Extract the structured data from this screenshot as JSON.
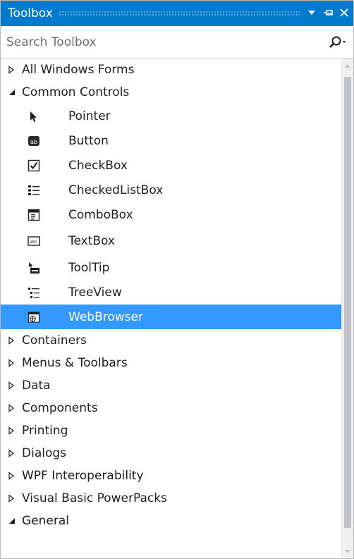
{
  "window": {
    "title": "Toolbox",
    "buttons": [
      "dropdown-icon",
      "pin-icon",
      "close-icon"
    ]
  },
  "search": {
    "placeholder": "Search Toolbox",
    "value": ""
  },
  "groups": [
    {
      "label": "All Windows Forms",
      "expanded": false
    },
    {
      "label": "Common Controls",
      "expanded": true,
      "items": [
        {
          "label": "Pointer",
          "icon": "pointer-icon"
        },
        {
          "label": "Button",
          "icon": "button-icon"
        },
        {
          "label": "CheckBox",
          "icon": "checkbox-icon"
        },
        {
          "label": "CheckedListBox",
          "icon": "checkedlistbox-icon"
        },
        {
          "label": "ComboBox",
          "icon": "combobox-icon"
        },
        {
          "label": "TextBox",
          "icon": "textbox-icon"
        },
        {
          "label": "ToolTip",
          "icon": "tooltip-icon"
        },
        {
          "label": "TreeView",
          "icon": "treeview-icon"
        },
        {
          "label": "WebBrowser",
          "icon": "webbrowser-icon",
          "selected": true
        }
      ]
    },
    {
      "label": "Containers",
      "expanded": false
    },
    {
      "label": "Menus & Toolbars",
      "expanded": false
    },
    {
      "label": "Data",
      "expanded": false
    },
    {
      "label": "Components",
      "expanded": false
    },
    {
      "label": "Printing",
      "expanded": false
    },
    {
      "label": "Dialogs",
      "expanded": false
    },
    {
      "label": "WPF Interoperability",
      "expanded": false
    },
    {
      "label": "Visual Basic PowerPacks",
      "expanded": false
    },
    {
      "label": "General",
      "expanded": true
    }
  ],
  "colors": {
    "titlebar": "#007acc",
    "selection": "#3399ff",
    "text": "#1e1e1e"
  }
}
